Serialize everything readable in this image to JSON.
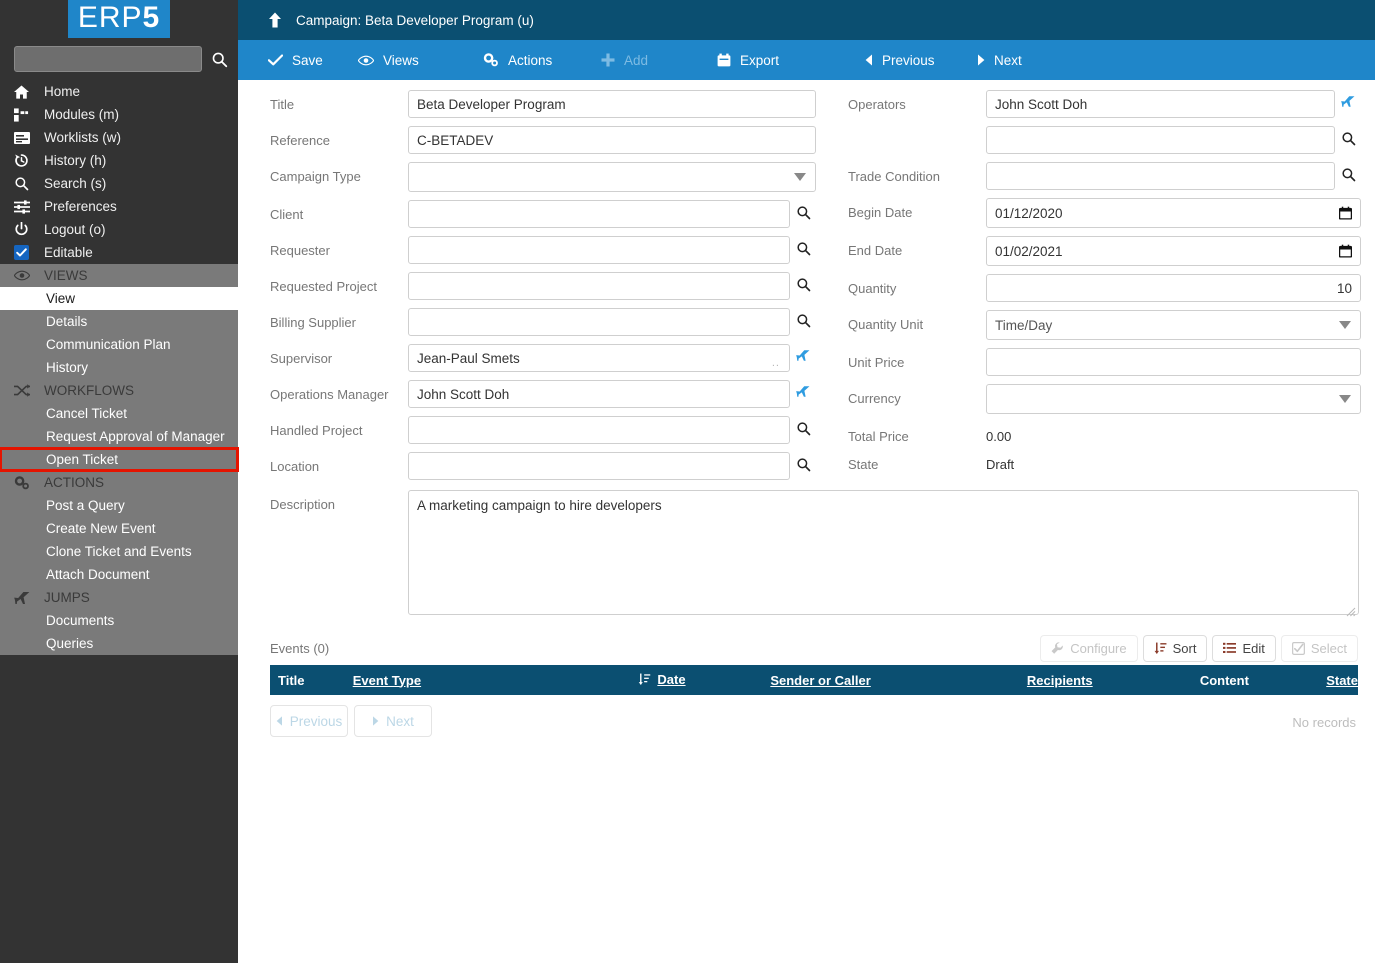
{
  "brand": {
    "name_prefix": "ERP",
    "name_suffix": "5",
    "accent": "#1f86c9"
  },
  "sidebar": {
    "search_placeholder": "",
    "search_value": "",
    "nav": [
      {
        "label": "Home",
        "icon": "home-icon"
      },
      {
        "label": "Modules (m)",
        "icon": "modules-icon"
      },
      {
        "label": "Worklists (w)",
        "icon": "worklists-icon"
      },
      {
        "label": "History (h)",
        "icon": "history-icon"
      },
      {
        "label": "Search (s)",
        "icon": "search-icon"
      },
      {
        "label": "Preferences",
        "icon": "sliders-icon"
      },
      {
        "label": "Logout (o)",
        "icon": "power-icon"
      },
      {
        "label": "Editable",
        "icon": "checkbox-checked-icon"
      }
    ],
    "sections": [
      {
        "title": "VIEWS",
        "icon": "eye-icon",
        "items": [
          {
            "label": "View",
            "state": "active"
          },
          {
            "label": "Details",
            "state": ""
          },
          {
            "label": "Communication Plan",
            "state": ""
          },
          {
            "label": "History",
            "state": ""
          }
        ]
      },
      {
        "title": "WORKFLOWS",
        "icon": "shuffle-icon",
        "items": [
          {
            "label": "Cancel Ticket",
            "state": ""
          },
          {
            "label": "Request Approval of Manager",
            "state": ""
          },
          {
            "label": "Open Ticket",
            "state": "highlighted"
          }
        ]
      },
      {
        "title": "ACTIONS",
        "icon": "cogs-icon",
        "items": [
          {
            "label": "Post a Query",
            "state": ""
          },
          {
            "label": "Create New Event",
            "state": ""
          },
          {
            "label": "Clone Ticket and Events",
            "state": ""
          },
          {
            "label": "Attach Document",
            "state": ""
          }
        ]
      },
      {
        "title": "JUMPS",
        "icon": "plane-icon",
        "items": [
          {
            "label": "Documents",
            "state": ""
          },
          {
            "label": "Queries",
            "state": ""
          }
        ]
      }
    ],
    "highlight_color": "#e51400"
  },
  "header": {
    "title": "Campaign: Beta Developer Program (u)",
    "up_icon": "arrow-up-icon"
  },
  "toolbar": {
    "buttons": [
      {
        "label": "Save",
        "icon": "check-icon",
        "disabled": false
      },
      {
        "label": "Views",
        "icon": "eye-icon",
        "disabled": false
      },
      {
        "label": "Actions",
        "icon": "cogs-icon",
        "disabled": false
      },
      {
        "label": "Add",
        "icon": "plus-icon",
        "disabled": true
      },
      {
        "label": "Export",
        "icon": "export-icon",
        "disabled": false
      },
      {
        "label": "Previous",
        "icon": "caret-left-icon",
        "disabled": false
      },
      {
        "label": "Next",
        "icon": "caret-right-icon",
        "disabled": false
      }
    ]
  },
  "form": {
    "left": {
      "title_label": "Title",
      "title_value": "Beta Developer Program",
      "reference_label": "Reference",
      "reference_value": "C-BETADEV",
      "campaign_type_label": "Campaign Type",
      "campaign_type_value": "",
      "client_label": "Client",
      "client_value": "",
      "requester_label": "Requester",
      "requester_value": "",
      "requested_project_label": "Requested Project",
      "requested_project_value": "",
      "billing_supplier_label": "Billing Supplier",
      "billing_supplier_value": "",
      "supervisor_label": "Supervisor",
      "supervisor_value": "Jean-Paul Smets",
      "supervisor_trail": "..",
      "operations_manager_label": "Operations Manager",
      "operations_manager_value": "John Scott Doh",
      "handled_project_label": "Handled Project",
      "handled_project_value": "",
      "location_label": "Location",
      "location_value": "",
      "description_label": "Description",
      "description_value": "A marketing campaign to hire developers"
    },
    "right": {
      "operators_label": "Operators",
      "operators_value": "John Scott Doh",
      "operators_extra_value": "",
      "trade_condition_label": "Trade Condition",
      "trade_condition_value": "",
      "begin_date_label": "Begin Date",
      "begin_date_value": "01/12/2020",
      "end_date_label": "End Date",
      "end_date_value": "01/02/2021",
      "quantity_label": "Quantity",
      "quantity_value": "10",
      "quantity_unit_label": "Quantity Unit",
      "quantity_unit_value": "Time/Day",
      "unit_price_label": "Unit Price",
      "unit_price_value": "",
      "currency_label": "Currency",
      "currency_value": "",
      "total_price_label": "Total Price",
      "total_price_value": "0.00",
      "state_label": "State",
      "state_value": "Draft"
    }
  },
  "events": {
    "title": "Events (0)",
    "tools": [
      {
        "label": "Configure",
        "icon": "wrench-icon",
        "disabled": true
      },
      {
        "label": "Sort",
        "icon": "sort-icon",
        "disabled": false
      },
      {
        "label": "Edit",
        "icon": "list-icon",
        "disabled": false
      },
      {
        "label": "Select",
        "icon": "checkbox-icon",
        "disabled": true
      }
    ],
    "columns": [
      {
        "label": "Title",
        "sortable": false,
        "sorted": false
      },
      {
        "label": "Event Type",
        "sortable": true,
        "sorted": false
      },
      {
        "label": "Date",
        "sortable": true,
        "sorted": true
      },
      {
        "label": "Sender or Caller",
        "sortable": true,
        "sorted": false
      },
      {
        "label": "Recipients",
        "sortable": true,
        "sorted": false
      },
      {
        "label": "Content",
        "sortable": false,
        "sorted": false
      },
      {
        "label": "State",
        "sortable": true,
        "sorted": false
      }
    ],
    "rows": [],
    "previous_label": "Previous",
    "next_label": "Next",
    "empty_text": "No records"
  }
}
